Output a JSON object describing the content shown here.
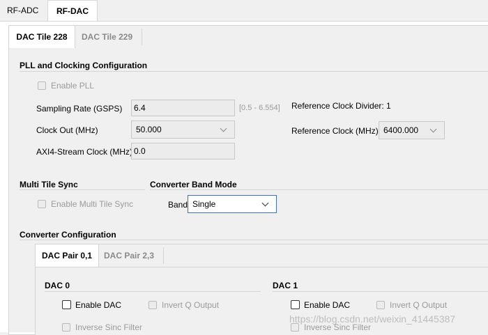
{
  "top_tabs": [
    "RF-ADC",
    "RF-DAC"
  ],
  "tile_tabs": [
    "DAC Tile 228",
    "DAC Tile 229"
  ],
  "pll": {
    "title": "PLL and Clocking Configuration",
    "enable_pll": "Enable PLL",
    "sampling_rate_label": "Sampling Rate (GSPS)",
    "sampling_rate_value": "6.4",
    "sampling_rate_range": "[0.5 - 6.554]",
    "ref_clock_divider": "Reference Clock Divider: 1",
    "clock_out_label": "Clock Out (MHz)",
    "clock_out_value": "50.000",
    "ref_clock_label": "Reference Clock (MHz)",
    "ref_clock_value": "6400.000",
    "axi_label": "AXI4-Stream Clock (MHz)",
    "axi_value": "0.0"
  },
  "mts": {
    "title": "Multi Tile Sync",
    "enable": "Enable Multi Tile Sync"
  },
  "band_mode": {
    "title": "Converter Band Mode",
    "band_label": "Band",
    "band_value": "Single"
  },
  "converter": {
    "title": "Converter Configuration",
    "pair_tabs": [
      "DAC Pair 0,1",
      "DAC Pair 2,3"
    ],
    "dac0": {
      "title": "DAC 0",
      "enable_dac": "Enable DAC",
      "invert_q": "Invert Q Output",
      "inverse_sinc": "Inverse Sinc Filter"
    },
    "dac1": {
      "title": "DAC 1",
      "enable_dac": "Enable DAC",
      "invert_q": "Invert Q Output",
      "inverse_sinc": "Inverse Sinc Filter"
    }
  },
  "watermark": "https://blog.csdn.net/weixin_41445387",
  "colors": {
    "focus_border": "#3b6fc9",
    "panel_bg": "#f0f0f0",
    "active_tab_bg": "#ffffff"
  }
}
